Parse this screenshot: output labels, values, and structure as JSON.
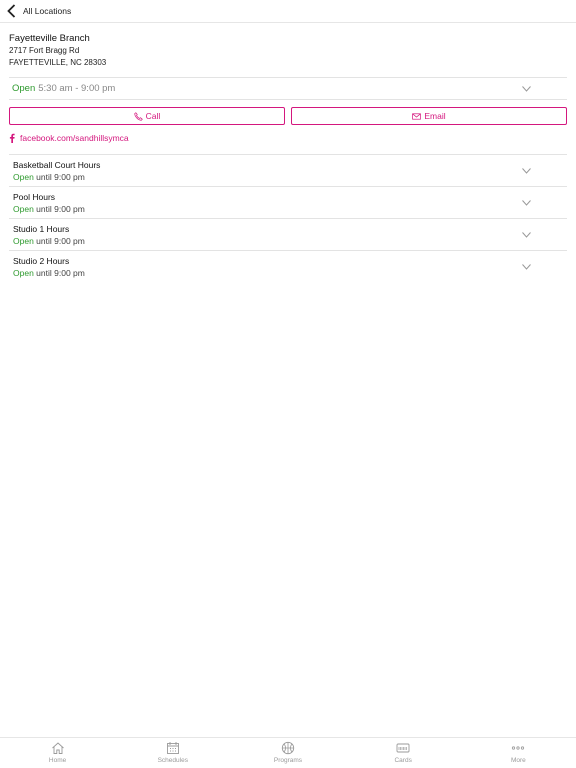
{
  "nav": {
    "back_label": "All Locations"
  },
  "branch": {
    "name": "Fayetteville Branch",
    "street": "2717 Fort Bragg Rd",
    "city": "FAYETTEVILLE, NC 28303"
  },
  "hours": {
    "status": "Open",
    "time": "5:30 am - 9:00 pm"
  },
  "actions": {
    "call_label": "Call",
    "email_label": "Email"
  },
  "social": {
    "facebook": "facebook.com/sandhillsymca"
  },
  "facilities": [
    {
      "name": "Basketball Court Hours",
      "status": "Open",
      "until": "until 9:00 pm"
    },
    {
      "name": "Pool Hours",
      "status": "Open",
      "until": "until 9:00 pm"
    },
    {
      "name": "Studio 1 Hours",
      "status": "Open",
      "until": "until 9:00 pm"
    },
    {
      "name": "Studio 2 Hours",
      "status": "Open",
      "until": "until 9:00 pm"
    }
  ],
  "tabs": [
    {
      "label": "Home",
      "icon": "home-icon"
    },
    {
      "label": "Schedules",
      "icon": "calendar-icon"
    },
    {
      "label": "Programs",
      "icon": "basketball-icon"
    },
    {
      "label": "Cards",
      "icon": "card-icon"
    },
    {
      "label": "More",
      "icon": "more-icon"
    }
  ],
  "colors": {
    "accent": "#d4177e",
    "open": "#2e9a2e",
    "tab_inactive": "#9a9a9a"
  }
}
